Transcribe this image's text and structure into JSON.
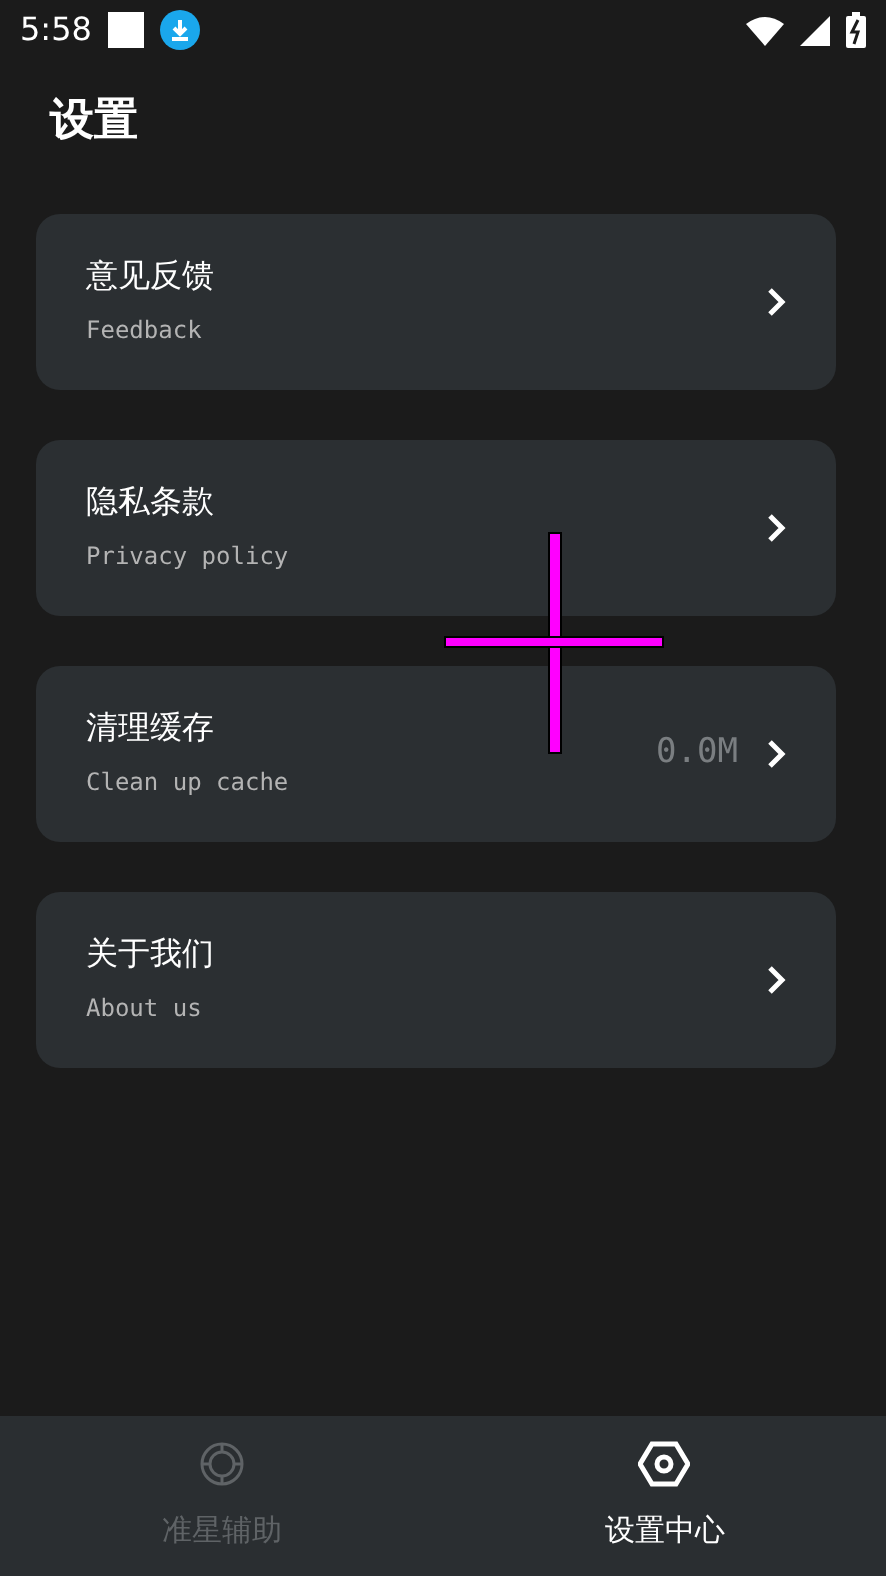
{
  "status_bar": {
    "time": "5:58"
  },
  "title": "设置",
  "items": [
    {
      "title": "意见反馈",
      "subtitle": "Feedback"
    },
    {
      "title": "隐私条款",
      "subtitle": "Privacy policy"
    },
    {
      "title": "清理缓存",
      "subtitle": "Clean up cache",
      "value": "0.0M"
    },
    {
      "title": "关于我们",
      "subtitle": "About us"
    }
  ],
  "overlay": {
    "kind": "crosshair"
  },
  "bottom_nav": [
    {
      "label": "准星辅助",
      "kind": "target",
      "selected": false
    },
    {
      "label": "设置中心",
      "kind": "hex",
      "selected": true
    }
  ]
}
